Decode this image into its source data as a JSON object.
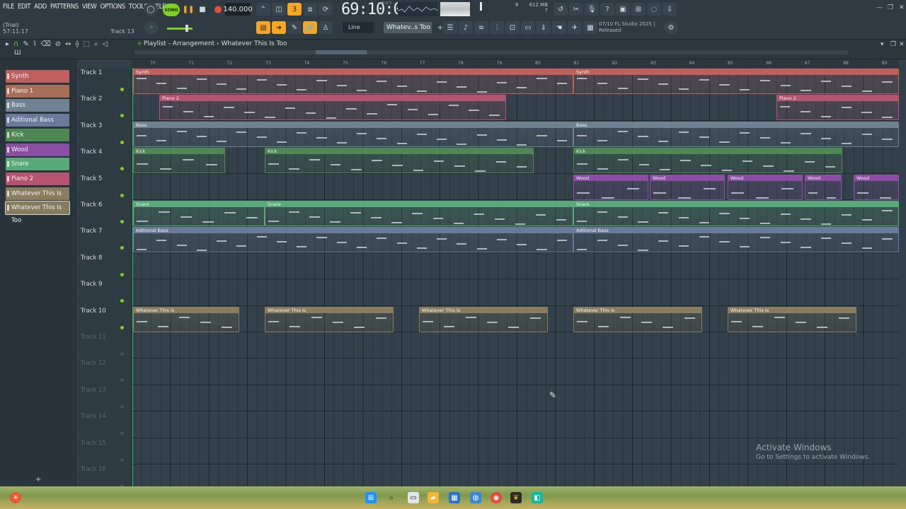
{
  "menu": [
    "FILE",
    "EDIT",
    "ADD",
    "PATTERNS",
    "VIEW",
    "OPTIONS",
    "TOOLS",
    "HELP"
  ],
  "trial_label": "(Trial)",
  "elapsed_time": "57:11:17",
  "focus_label": "Track 13",
  "song_mode": "SONG",
  "tempo": "140.000",
  "time_display": "69:10:03",
  "time_unit": "B:S:T",
  "cpu_value": "8",
  "memory": "612 MB",
  "memory_sub": "7",
  "snap_mode": "Line",
  "pattern_selector": "Whatev..s Too",
  "hint": {
    "line1": "07/10  FL Studio 2025 |",
    "line2": "Released"
  },
  "playlist_title": "Playlist - Arrangement › Whatever This Is Too",
  "picker": [
    {
      "label": "Synth",
      "color": "#c0605e"
    },
    {
      "label": "Piano 1",
      "color": "#a96e5a"
    },
    {
      "label": "Bass",
      "color": "#6f8291"
    },
    {
      "label": "Aditional Bass",
      "color": "#6a7a9a"
    },
    {
      "label": "Kick",
      "color": "#4f8754"
    },
    {
      "label": "Wood",
      "color": "#8a4ea2"
    },
    {
      "label": "Snare",
      "color": "#58aa78"
    },
    {
      "label": "Piano 2",
      "color": "#b45471"
    },
    {
      "label": "Whatever This Is",
      "color": "#8a7c5f"
    },
    {
      "label": "Whatever This Is Too",
      "color": "#887a5d"
    }
  ],
  "tracks": [
    "Track 1",
    "Track 2",
    "Track 3",
    "Track 4",
    "Track 5",
    "Track 6",
    "Track 7",
    "Track 8",
    "Track 9",
    "Track 10",
    "Track 11",
    "Track 12",
    "Track 13",
    "Track 14",
    "Track 15",
    "Track 16"
  ],
  "ruler_bars": [
    "70",
    "71",
    "72",
    "73",
    "74",
    "75",
    "76",
    "77",
    "78",
    "79",
    "80",
    "81",
    "82",
    "83",
    "84",
    "85",
    "86",
    "87",
    "88",
    "89"
  ],
  "clips": {
    "synth1": "Synth",
    "synth2": "Synth",
    "piano2a": "Piano 2",
    "piano2b": "Piano 2",
    "bass1": "Bass",
    "bass2": "Bass",
    "kick1": "Kick",
    "kick2": "Kick",
    "kick3": "Kick",
    "wood1": "Wood",
    "wood2": "Wood",
    "wood3": "Wood",
    "wood4": "Wood",
    "wood5": "Wood",
    "snare1": "Snare",
    "snare2": "Snare",
    "snare3": "Snare",
    "addbass1": "Aditional Bass",
    "addbass2": "Aditional Bass",
    "what1": "Whatever This Is",
    "what2": "Whatever This Is",
    "what3": "Whatever This Is",
    "what4": "Whatever This Is",
    "what5": "Whatever This Is"
  },
  "watermark": {
    "title": "Activate Windows",
    "subtitle": "Go to Settings to activate Windows."
  },
  "colors": {
    "accent_green": "#7ed321",
    "synth": "#c0605e",
    "piano2": "#b45471",
    "bass": "#6f8291",
    "kick": "#4f8754",
    "wood": "#8a4ea2",
    "snare": "#58aa78",
    "addbass": "#6a7a9a",
    "whatever": "#8a7c5f"
  }
}
